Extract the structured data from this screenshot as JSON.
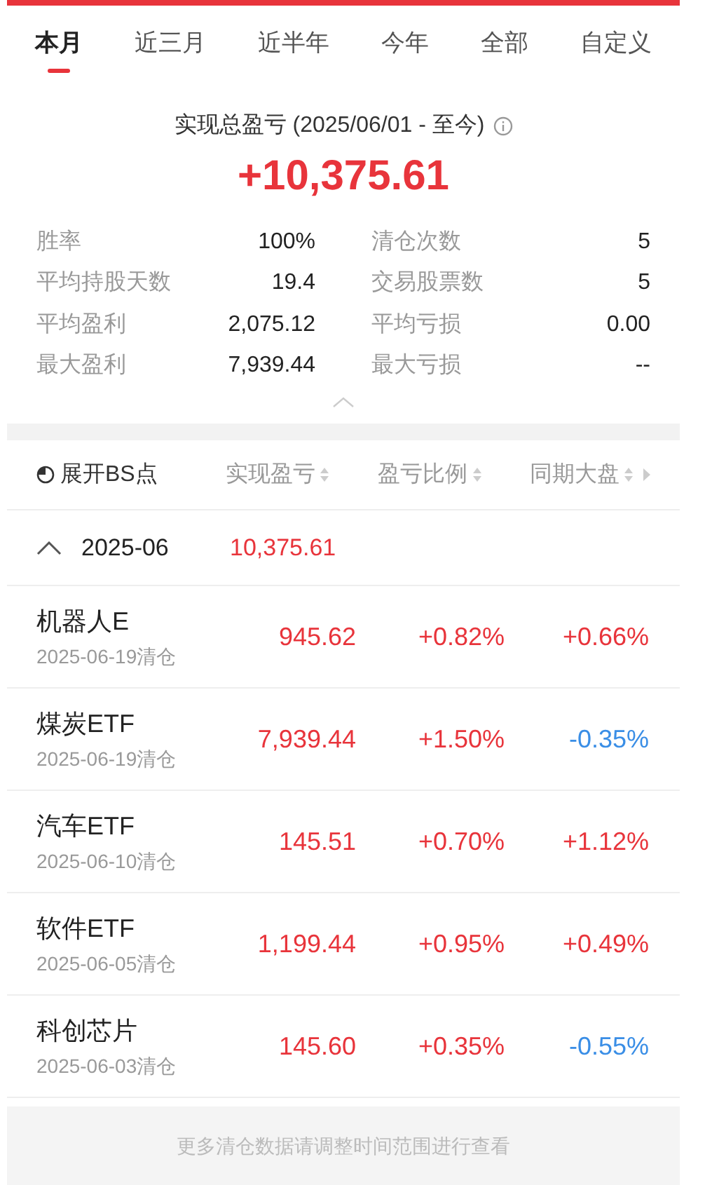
{
  "tabs": [
    {
      "label": "本月",
      "selected": true
    },
    {
      "label": "近三月",
      "selected": false
    },
    {
      "label": "近半年",
      "selected": false
    },
    {
      "label": "今年",
      "selected": false
    },
    {
      "label": "全部",
      "selected": false
    },
    {
      "label": "自定义",
      "selected": false
    }
  ],
  "summary": {
    "title": "实现总盈亏 (2025/06/01 - 至今)",
    "total": "+10,375.61"
  },
  "stats": [
    {
      "label": "胜率",
      "value": "100%"
    },
    {
      "label": "清仓次数",
      "value": "5"
    },
    {
      "label": "平均持股天数",
      "value": "19.4"
    },
    {
      "label": "交易股票数",
      "value": "5"
    },
    {
      "label": "平均盈利",
      "value": "2,075.12"
    },
    {
      "label": "平均亏损",
      "value": "0.00"
    },
    {
      "label": "最大盈利",
      "value": "7,939.44"
    },
    {
      "label": "最大亏损",
      "value": "--"
    }
  ],
  "table": {
    "toggle": "展开BS点",
    "columns": [
      "实现盈亏",
      "盈亏比例",
      "同期大盘"
    ],
    "group": {
      "label": "2025-06",
      "value": "10,375.61",
      "expanded": true
    },
    "rows": [
      {
        "name": "机器人E",
        "date": "2025-06-19清仓",
        "pnl": "945.62",
        "ratio": "+0.82%",
        "market": "+0.66%",
        "market_up": true
      },
      {
        "name": "煤炭ETF",
        "date": "2025-06-19清仓",
        "pnl": "7,939.44",
        "ratio": "+1.50%",
        "market": "-0.35%",
        "market_up": false
      },
      {
        "name": "汽车ETF",
        "date": "2025-06-10清仓",
        "pnl": "145.51",
        "ratio": "+0.70%",
        "market": "+1.12%",
        "market_up": true
      },
      {
        "name": "软件ETF",
        "date": "2025-06-05清仓",
        "pnl": "1,199.44",
        "ratio": "+0.95%",
        "market": "+0.49%",
        "market_up": true
      },
      {
        "name": "科创芯片",
        "date": "2025-06-03清仓",
        "pnl": "145.60",
        "ratio": "+0.35%",
        "market": "-0.55%",
        "market_up": false
      }
    ]
  },
  "footer": "更多清仓数据请调整时间范围进行查看"
}
